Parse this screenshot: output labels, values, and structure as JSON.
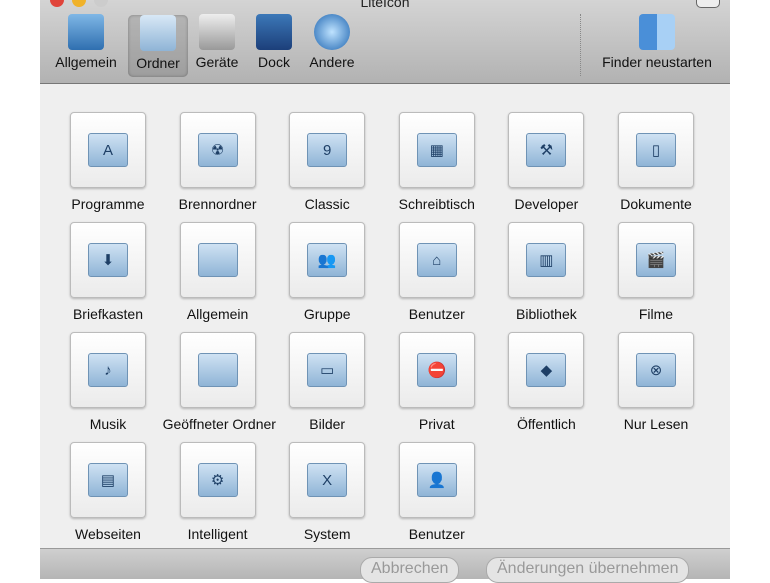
{
  "window": {
    "title": "LiteIcon"
  },
  "toolbar": {
    "items": [
      {
        "label": "Allgemein",
        "icon": "monitor-icon"
      },
      {
        "label": "Ordner",
        "icon": "folder-icon",
        "selected": true
      },
      {
        "label": "Geräte",
        "icon": "hard-drive-icon"
      },
      {
        "label": "Dock",
        "icon": "dock-icon"
      },
      {
        "label": "Andere",
        "icon": "globe-icon"
      }
    ],
    "restart": {
      "label": "Finder neustarten",
      "icon": "finder-icon"
    }
  },
  "folders": [
    {
      "label": "Programme",
      "glyph": "A"
    },
    {
      "label": "Brennordner",
      "glyph": "☢"
    },
    {
      "label": "Classic",
      "glyph": "9"
    },
    {
      "label": "Schreibtisch",
      "glyph": "▦"
    },
    {
      "label": "Developer",
      "glyph": "⚒"
    },
    {
      "label": "Dokumente",
      "glyph": "▯"
    },
    {
      "label": "Briefkasten",
      "glyph": "⬇"
    },
    {
      "label": "Allgemein",
      "glyph": ""
    },
    {
      "label": "Gruppe",
      "glyph": "👥"
    },
    {
      "label": "Benutzer",
      "glyph": "⌂"
    },
    {
      "label": "Bibliothek",
      "glyph": "▥"
    },
    {
      "label": "Filme",
      "glyph": "🎬"
    },
    {
      "label": "Musik",
      "glyph": "♪"
    },
    {
      "label": "Geöffneter Ordner",
      "glyph": ""
    },
    {
      "label": "Bilder",
      "glyph": "▭"
    },
    {
      "label": "Privat",
      "glyph": "⛔"
    },
    {
      "label": "Öffentlich",
      "glyph": "◆"
    },
    {
      "label": "Nur Lesen",
      "glyph": "⊗"
    },
    {
      "label": "Webseiten",
      "glyph": "▤"
    },
    {
      "label": "Intelligent",
      "glyph": "⚙"
    },
    {
      "label": "System",
      "glyph": "X"
    },
    {
      "label": "Benutzer",
      "glyph": "👤"
    }
  ],
  "buttons": {
    "cancel": "Abbrechen",
    "apply": "Änderungen übernehmen"
  }
}
